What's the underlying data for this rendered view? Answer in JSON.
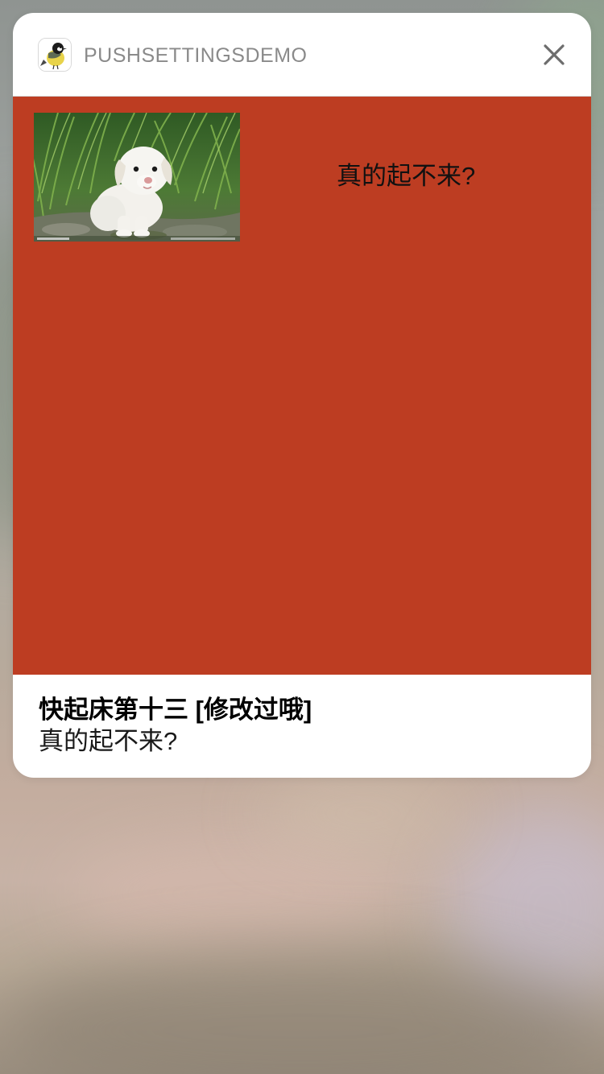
{
  "notification": {
    "app_icon": "bird-app-icon",
    "app_name": "PUSHSETTINGSDEMO",
    "close_icon": "close-icon",
    "content": {
      "background_color": "#bd3d22",
      "image": "puppy-image",
      "text": "真的起不来?"
    },
    "title": "快起床第十三 [修改过哦]",
    "body": "真的起不来?"
  }
}
